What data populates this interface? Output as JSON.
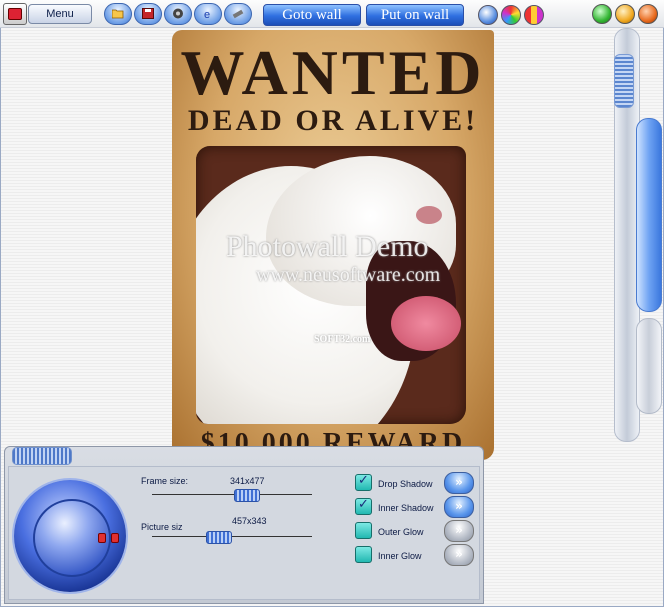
{
  "toolbar": {
    "menu_label": "Menu",
    "goto_wall_label": "Goto wall",
    "put_on_wall_label": "Put on wall"
  },
  "poster": {
    "title": "WANTED",
    "subtitle": "DEAD OR ALIVE!",
    "reward": "$10,000 REWARD",
    "watermark_title": "Photowall Demo",
    "watermark_url": "www.neusoftware.com",
    "watermark_small": "SOFT32.com"
  },
  "panel": {
    "frame_size_label": "Frame size:",
    "frame_size_value": "341x477",
    "frame_size_slider_fraction": 0.59,
    "picture_size_label": "Picture siz",
    "picture_size_value": "457x343",
    "picture_size_slider_fraction": 0.41,
    "options": [
      {
        "label": "Drop Shadow",
        "checked": true,
        "active": true
      },
      {
        "label": "Inner Shadow",
        "checked": true,
        "active": true
      },
      {
        "label": "Outer Glow",
        "checked": false,
        "active": false
      },
      {
        "label": "Inner Glow",
        "checked": false,
        "active": false
      }
    ]
  },
  "icons": [
    "app-icon",
    "open-folder-icon",
    "save-icon",
    "print-icon",
    "internet-explorer-icon",
    "settings-tool-icon",
    "globe-icon",
    "color-palette-icon",
    "stripes-icon",
    "minimize-icon",
    "maximize-icon",
    "close-icon",
    "chevron-right-icon"
  ],
  "colors": {
    "accent": "#2f6fe0",
    "panel": "#d3d8e0",
    "checkbox": "#22b8b1"
  }
}
